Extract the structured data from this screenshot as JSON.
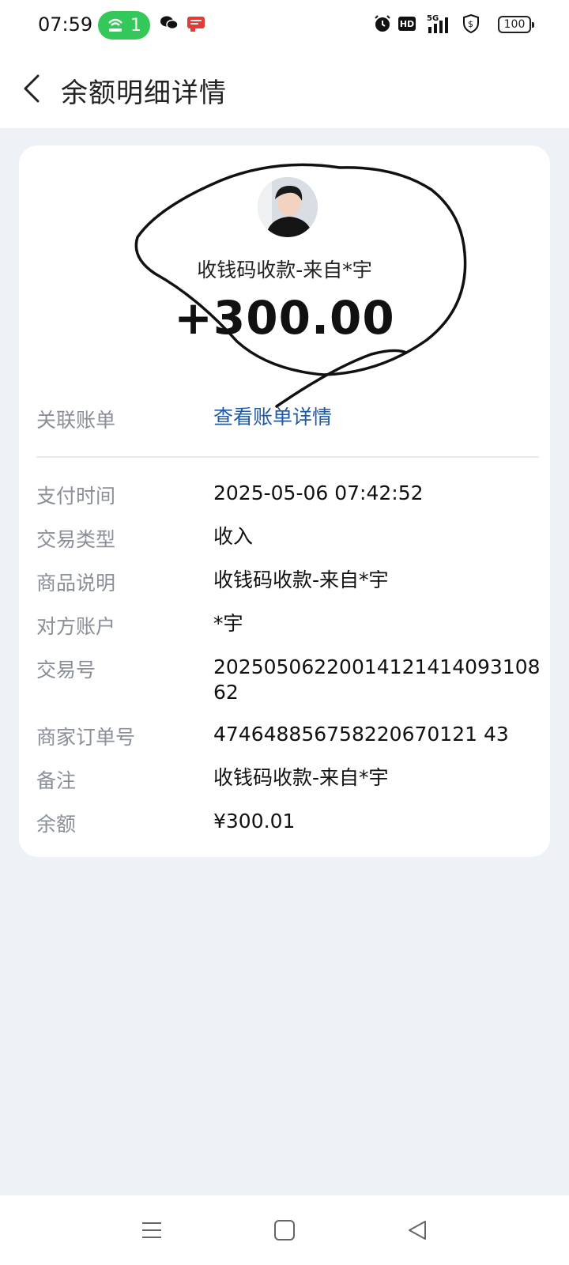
{
  "status_bar": {
    "time": "07:59",
    "hotspot_count": "1",
    "battery": "100",
    "network": "5G",
    "hd": "HD"
  },
  "header": {
    "title": "余额明细详情",
    "back_icon": "chevron-left-icon"
  },
  "transaction": {
    "title": "收钱码收款-来自*宇",
    "amount": "+300.00"
  },
  "linked_bill": {
    "label": "关联账单",
    "link_text": "查看账单详情"
  },
  "details": [
    {
      "label": "支付时间",
      "value": "2025-05-06 07:42:52"
    },
    {
      "label": "交易类型",
      "value": "收入"
    },
    {
      "label": "商品说明",
      "value": "收钱码收款-来自*宇"
    },
    {
      "label": "对方账户",
      "value": "*宇"
    },
    {
      "label": "交易号",
      "value": "20250506220014121414093108 62"
    },
    {
      "label": "商家订单号",
      "value": "474648856758220670121 43"
    },
    {
      "label": "备注",
      "value": "收钱码收款-来自*宇"
    },
    {
      "label": "余额",
      "value": "¥300.01"
    }
  ],
  "colors": {
    "link": "#1f5aa8",
    "background": "#eef1f6",
    "hotspot_pill": "#34c759"
  }
}
